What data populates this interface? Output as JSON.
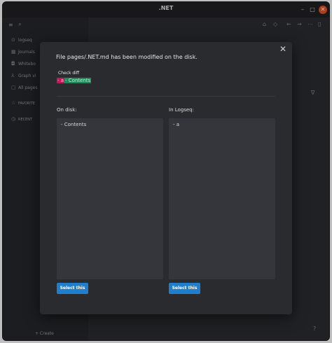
{
  "window": {
    "title": ".NET",
    "minimize": "–",
    "maximize": "□",
    "close": "✕"
  },
  "toolbar": {
    "menu_icon": "≡",
    "search_icon": "⌕",
    "right_icons": [
      "⌂",
      "◇",
      "←",
      "→",
      "⋯",
      "▯"
    ]
  },
  "sidebar": {
    "items": [
      {
        "icon": "⊙",
        "label": "logseq"
      },
      {
        "icon": "▦",
        "label": "Journals"
      },
      {
        "icon": "◘",
        "label": "Whitebo"
      },
      {
        "icon": "⅄",
        "label": "Graph vi"
      },
      {
        "icon": "▢",
        "label": "All pages"
      }
    ],
    "favorites_label": "FAVORITE",
    "recent_label": "RECENT",
    "create_label": "+ Create"
  },
  "main": {
    "filter_icon": "∇",
    "help_icon": "?"
  },
  "modal": {
    "close_icon": "✕",
    "message": "File pages/.NET.md has been modified on the disk.",
    "check_diff": "Check diff",
    "diff": {
      "removed": "- a",
      "added": "- Contents"
    },
    "on_disk_label": "On disk:",
    "in_logseq_label": "In Logseq:",
    "on_disk_content": "- Contents",
    "in_logseq_content": "- a",
    "select_left_label": "Select this",
    "select_right_label": "Select this"
  }
}
